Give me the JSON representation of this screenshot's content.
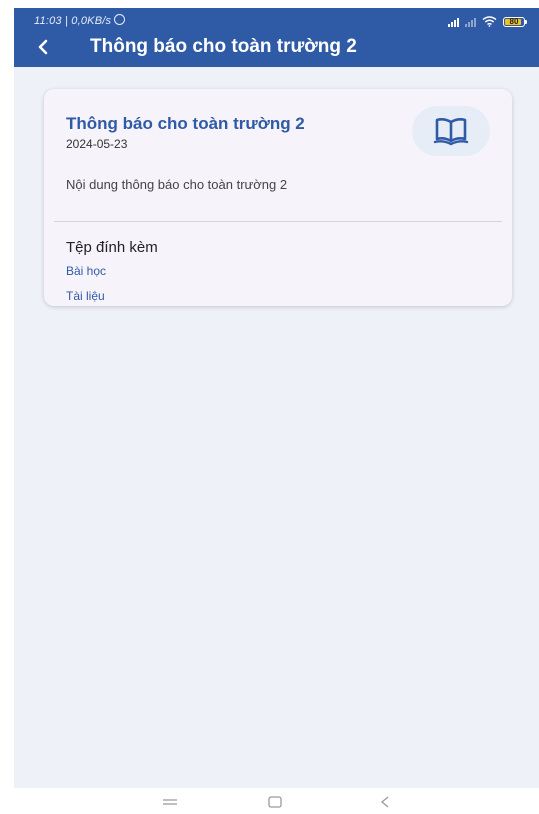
{
  "status_bar": {
    "time": "11:03 | 0,0KB/s",
    "battery": "80"
  },
  "header": {
    "title": "Thông báo cho toàn trường 2"
  },
  "notice": {
    "title": "Thông báo cho toàn trường 2",
    "date": "2024-05-23",
    "content": "Nội dung thông báo cho toàn trường 2",
    "icon": "open-book-icon"
  },
  "attachments": {
    "heading": "Tệp đính kèm",
    "items": [
      {
        "label": "Bài học"
      },
      {
        "label": "Tài liệu"
      }
    ]
  },
  "colors": {
    "primary": "#2f5aa6",
    "background": "#eef2f8",
    "card": "#f6f3fa"
  }
}
